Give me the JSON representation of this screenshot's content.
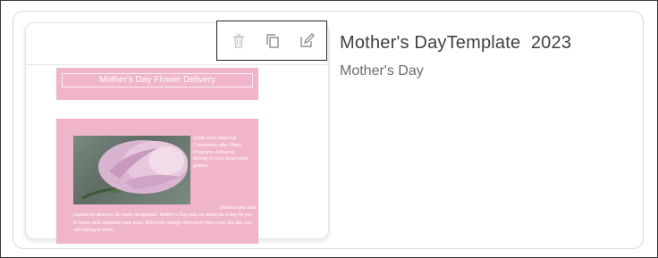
{
  "template": {
    "title": "Mother's DayTemplate  2023",
    "category": "Mother's Day"
  },
  "toolbar": {
    "delete_icon": "trash-icon",
    "copy_icon": "copy-icon",
    "edit_icon": "edit-icon"
  },
  "email_preview": {
    "banner_text": "Mother's Day Flower Delivery",
    "side_text": "South East Regional Cemeteries offer Floral Programs delivered directly to your loved-ones graves.",
    "body_lead": "Mothers who bas",
    "body_text": "passed on deserve as much recognition. Mother's Day was set aside as a day for you to honor and celebrate your mum. And even though they aren't here now, the day can still belong to them.",
    "colors": {
      "pink": "#f0b4cb"
    }
  }
}
